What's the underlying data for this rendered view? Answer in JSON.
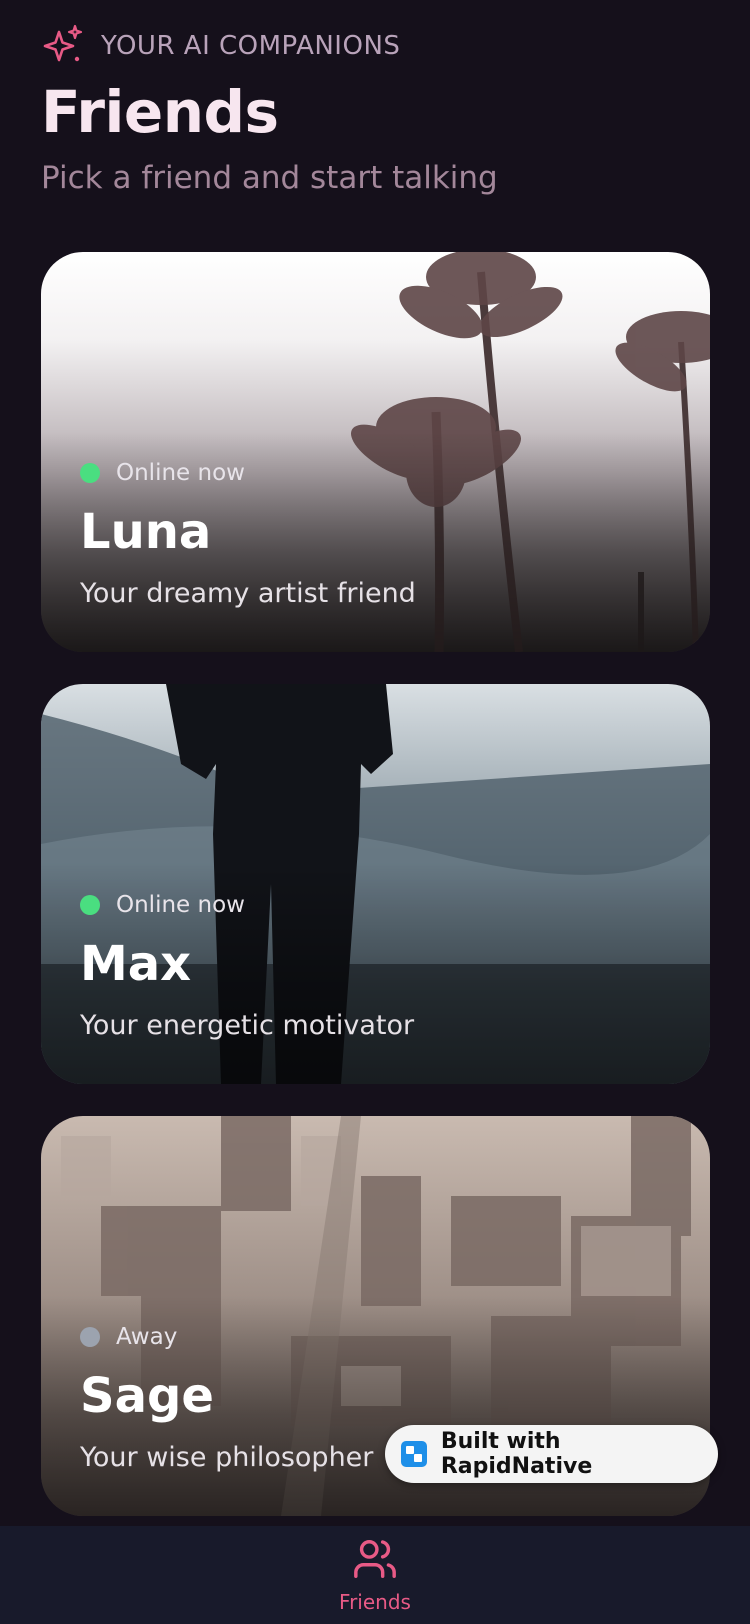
{
  "header": {
    "eyebrow": "YOUR AI COMPANIONS",
    "eyebrow_icon": "sparkles-icon",
    "title": "Friends",
    "subtitle": "Pick a friend and start talking"
  },
  "friends": [
    {
      "name": "Luna",
      "status": "Online now",
      "status_color": "#4ade80",
      "description": "Your dreamy artist friend"
    },
    {
      "name": "Max",
      "status": "Online now",
      "status_color": "#4ade80",
      "description": "Your energetic motivator"
    },
    {
      "name": "Sage",
      "status": "Away",
      "status_color": "#9ca3af",
      "description": "Your wise philosopher"
    }
  ],
  "badge": {
    "label": "Built with RapidNative",
    "icon": "rapidnative-logo-icon"
  },
  "tabbar": {
    "tabs": [
      {
        "label": "Friends",
        "icon": "users-icon",
        "active": true
      }
    ]
  },
  "colors": {
    "background": "#15101b",
    "accent": "#e85a86",
    "tabbar": "#181a2b"
  }
}
